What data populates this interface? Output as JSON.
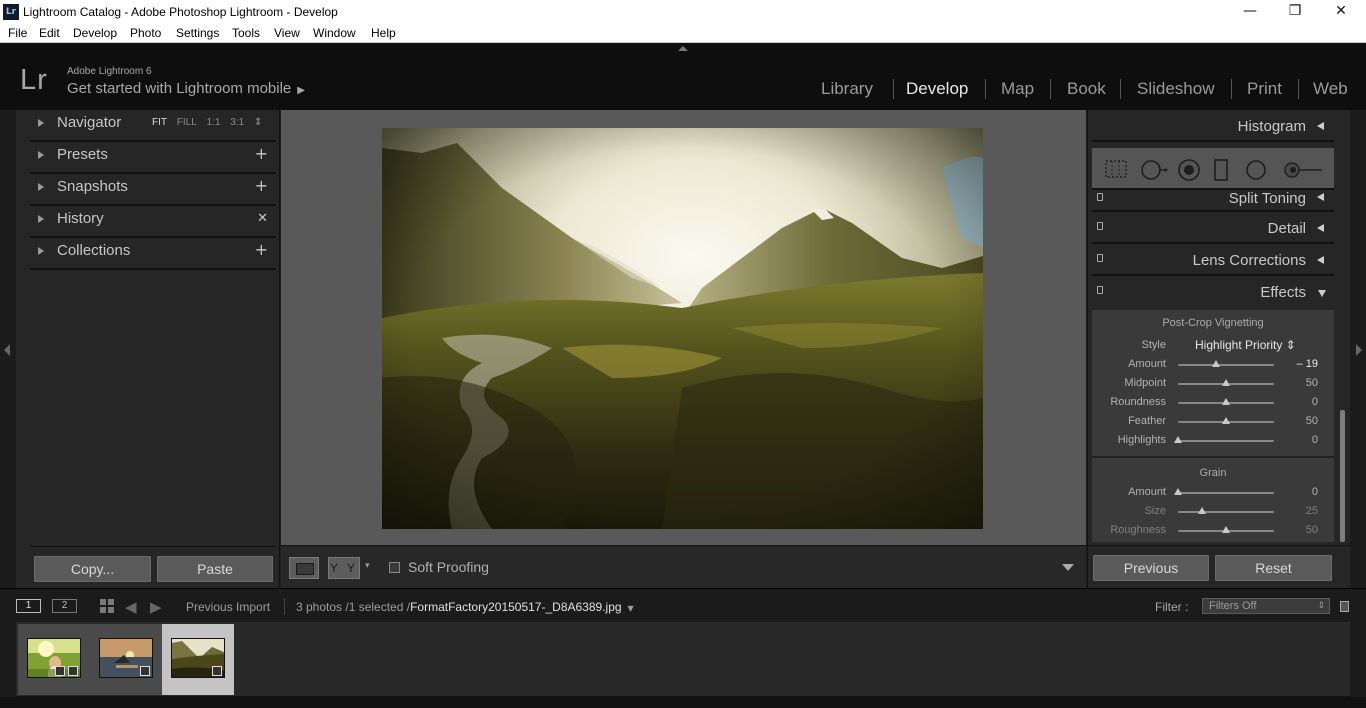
{
  "window": {
    "app_icon": "Lr",
    "title": "Lightroom Catalog - Adobe Photoshop Lightroom - Develop",
    "controls": {
      "minimize": "—",
      "restore": "❐",
      "close": "✕"
    }
  },
  "menu": [
    "File",
    "Edit",
    "Develop",
    "Photo",
    "Settings",
    "Tools",
    "View",
    "Window",
    "Help"
  ],
  "identity": {
    "logo": "Lr",
    "product": "Adobe Lightroom 6",
    "mobile_prompt": "Get started with Lightroom mobile",
    "mobile_arrow": "▶"
  },
  "modules": [
    {
      "label": "Library",
      "active": false
    },
    {
      "label": "Develop",
      "active": true
    },
    {
      "label": "Map",
      "active": false
    },
    {
      "label": "Book",
      "active": false
    },
    {
      "label": "Slideshow",
      "active": false
    },
    {
      "label": "Print",
      "active": false
    },
    {
      "label": "Web",
      "active": false
    }
  ],
  "left_panel": {
    "navigator": {
      "label": "Navigator",
      "zoom": [
        "FIT",
        "FILL",
        "1:1",
        "3:1"
      ],
      "selected_zoom": "FIT",
      "zoom_stepper": "⇕"
    },
    "presets": {
      "label": "Presets",
      "action": "+"
    },
    "snapshots": {
      "label": "Snapshots",
      "action": "+"
    },
    "history": {
      "label": "History",
      "action": "✕"
    },
    "collections": {
      "label": "Collections",
      "action": "+"
    },
    "copy_label": "Copy...",
    "paste_label": "Paste"
  },
  "toolbar": {
    "yy_label": "Y Y",
    "yy_dropdown": "▾",
    "soft_proofing_label": "Soft Proofing",
    "soft_proofing_checked": false
  },
  "right_panel": {
    "histogram": "Histogram",
    "tool_icons": [
      "crop-overlay-icon",
      "spot-removal-icon",
      "red-eye-icon",
      "graduated-filter-icon",
      "radial-filter-icon",
      "adjustment-brush-icon"
    ],
    "sections": [
      "Split Toning",
      "Detail",
      "Lens Corrections",
      "Effects"
    ],
    "effects": {
      "vignette_title": "Post-Crop Vignetting",
      "style_label": "Style",
      "style_value": "Highlight Priority ⇕",
      "vignette_sliders": [
        {
          "label": "Amount",
          "value": "– 19",
          "pos": 0.4,
          "highlight": true
        },
        {
          "label": "Midpoint",
          "value": "50",
          "pos": 0.5
        },
        {
          "label": "Roundness",
          "value": "0",
          "pos": 0.5
        },
        {
          "label": "Feather",
          "value": "50",
          "pos": 0.5
        },
        {
          "label": "Highlights",
          "value": "0",
          "pos": 0.0
        }
      ],
      "grain_title": "Grain",
      "grain_sliders": [
        {
          "label": "Amount",
          "value": "0",
          "pos": 0.0
        },
        {
          "label": "Size",
          "value": "25",
          "pos": 0.25,
          "dim": true
        },
        {
          "label": "Roughness",
          "value": "50",
          "pos": 0.5,
          "dim": true
        }
      ]
    },
    "previous_label": "Previous",
    "reset_label": "Reset"
  },
  "filmstrip": {
    "monitor1": "1",
    "monitor2": "2",
    "back_arrow": "◀",
    "forward_arrow": "▶",
    "source": "Previous Import",
    "info": "3 photos /1 selected /",
    "filename": "FormatFactory20150517-_D8A6389.jpg",
    "filename_dropdown": "▼",
    "filter_label": "Filter :",
    "filter_value": "Filters Off",
    "filter_stepper": "⇕",
    "thumbnails": [
      {
        "name": "woman-field",
        "selected": false
      },
      {
        "name": "sunset-lake",
        "selected": false
      },
      {
        "name": "mountain-valley",
        "selected": true
      }
    ]
  },
  "colors": {
    "accent": "#e8e8e8",
    "panel": "#262626",
    "identity": "#0e0e0e"
  }
}
